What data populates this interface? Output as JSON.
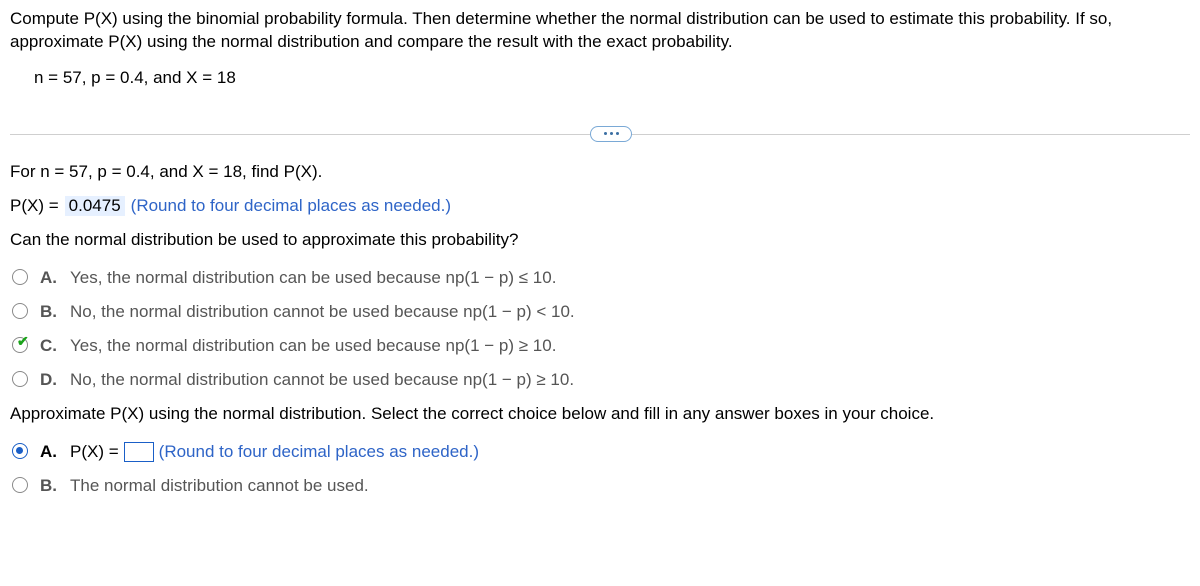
{
  "intro": "Compute P(X) using the binomial probability formula. Then determine whether the normal distribution can be used to estimate this probability. If so, approximate P(X) using the normal distribution and compare the result with the exact probability.",
  "params": "n = 57, p = 0.4, and X = 18",
  "q1": {
    "prompt": "For n = 57, p = 0.4, and X = 18, find P(X).",
    "lhs": "P(X) =",
    "value": "0.0475",
    "hint": "(Round to four decimal places as needed.)"
  },
  "q2": {
    "prompt": "Can the normal distribution be used to approximate this probability?",
    "choices": [
      {
        "letter": "A.",
        "text": "Yes, the normal distribution can be used because np(1 − p) ≤ 10."
      },
      {
        "letter": "B.",
        "text": "No, the normal distribution cannot be used because np(1 − p) < 10."
      },
      {
        "letter": "C.",
        "text": "Yes, the normal distribution can be used because np(1 − p) ≥ 10."
      },
      {
        "letter": "D.",
        "text": "No, the normal distribution cannot be used because np(1 − p) ≥ 10."
      }
    ],
    "correct_index": 2
  },
  "q3": {
    "prompt": "Approximate P(X) using the normal distribution. Select the correct choice below and fill in any answer boxes in your choice.",
    "choices": [
      {
        "letter": "A.",
        "prefix": "P(X) =",
        "value": "",
        "hint": "(Round to four decimal places as needed.)"
      },
      {
        "letter": "B.",
        "text": "The normal distribution cannot be used."
      }
    ],
    "selected_index": 0
  }
}
